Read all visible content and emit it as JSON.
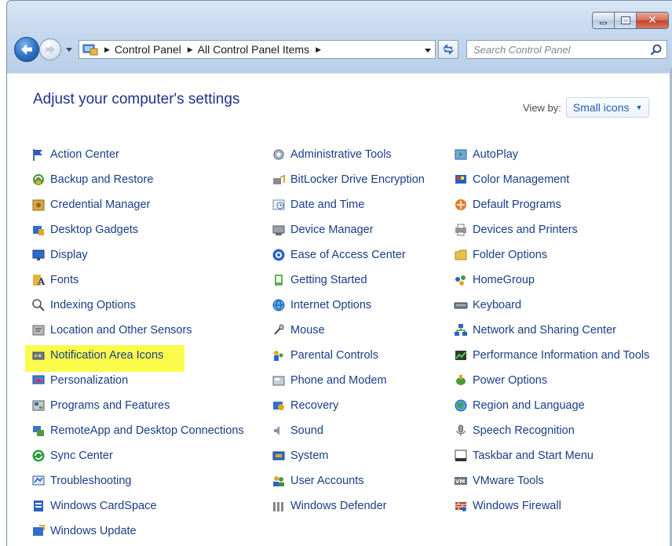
{
  "window": {
    "caption_buttons": [
      {
        "name": "minimize-icon"
      },
      {
        "name": "maximize-icon"
      },
      {
        "name": "close-icon",
        "glyph": "✕"
      }
    ]
  },
  "nav": {
    "breadcrumbs": [
      "Control Panel",
      "All Control Panel Items"
    ],
    "search_placeholder": "Search Control Panel"
  },
  "header": {
    "title": "Adjust your computer's settings",
    "view_by_label": "View by:",
    "view_by_value": "Small icons"
  },
  "colors": {
    "link": "#1a3d86",
    "title": "#1e3287",
    "highlight": "#fbfb4c",
    "view_value": "#1e5fb0"
  },
  "columns": [
    [
      {
        "label": "Action Center",
        "icon": "flag-icon"
      },
      {
        "label": "Backup and Restore",
        "icon": "backup-icon"
      },
      {
        "label": "Credential Manager",
        "icon": "vault-icon"
      },
      {
        "label": "Desktop Gadgets",
        "icon": "gadgets-icon"
      },
      {
        "label": "Display",
        "icon": "monitor-icon"
      },
      {
        "label": "Fonts",
        "icon": "fonts-icon"
      },
      {
        "label": "Indexing Options",
        "icon": "indexing-icon"
      },
      {
        "label": "Location and Other Sensors",
        "icon": "sensor-icon"
      },
      {
        "label": "Notification Area Icons",
        "icon": "notification-icon",
        "highlighted": true
      },
      {
        "label": "Personalization",
        "icon": "personalization-icon"
      },
      {
        "label": "Programs and Features",
        "icon": "programs-icon"
      },
      {
        "label": "RemoteApp and Desktop Connections",
        "icon": "remoteapp-icon"
      },
      {
        "label": "Sync Center",
        "icon": "sync-icon"
      },
      {
        "label": "Troubleshooting",
        "icon": "troubleshoot-icon"
      },
      {
        "label": "Windows CardSpace",
        "icon": "cardspace-icon"
      },
      {
        "label": "Windows Update",
        "icon": "update-icon"
      }
    ],
    [
      {
        "label": "Administrative Tools",
        "icon": "admin-tools-icon"
      },
      {
        "label": "BitLocker Drive Encryption",
        "icon": "bitlocker-icon"
      },
      {
        "label": "Date and Time",
        "icon": "clock-icon"
      },
      {
        "label": "Device Manager",
        "icon": "device-manager-icon"
      },
      {
        "label": "Ease of Access Center",
        "icon": "ease-access-icon"
      },
      {
        "label": "Getting Started",
        "icon": "getting-started-icon"
      },
      {
        "label": "Internet Options",
        "icon": "globe-icon"
      },
      {
        "label": "Mouse",
        "icon": "mouse-icon"
      },
      {
        "label": "Parental Controls",
        "icon": "parental-icon"
      },
      {
        "label": "Phone and Modem",
        "icon": "phone-icon"
      },
      {
        "label": "Recovery",
        "icon": "recovery-icon"
      },
      {
        "label": "Sound",
        "icon": "speaker-icon"
      },
      {
        "label": "System",
        "icon": "system-icon"
      },
      {
        "label": "User Accounts",
        "icon": "users-icon"
      },
      {
        "label": "Windows Defender",
        "icon": "defender-icon"
      }
    ],
    [
      {
        "label": "AutoPlay",
        "icon": "autoplay-icon"
      },
      {
        "label": "Color Management",
        "icon": "color-icon"
      },
      {
        "label": "Default Programs",
        "icon": "default-programs-icon"
      },
      {
        "label": "Devices and Printers",
        "icon": "printer-icon"
      },
      {
        "label": "Folder Options",
        "icon": "folder-icon"
      },
      {
        "label": "HomeGroup",
        "icon": "homegroup-icon"
      },
      {
        "label": "Keyboard",
        "icon": "keyboard-icon"
      },
      {
        "label": "Network and Sharing Center",
        "icon": "network-icon"
      },
      {
        "label": "Performance Information and Tools",
        "icon": "performance-icon"
      },
      {
        "label": "Power Options",
        "icon": "power-icon"
      },
      {
        "label": "Region and Language",
        "icon": "region-icon"
      },
      {
        "label": "Speech Recognition",
        "icon": "microphone-icon"
      },
      {
        "label": "Taskbar and Start Menu",
        "icon": "taskbar-icon"
      },
      {
        "label": "VMware Tools",
        "icon": "vmware-icon"
      },
      {
        "label": "Windows Firewall",
        "icon": "firewall-icon"
      }
    ]
  ]
}
